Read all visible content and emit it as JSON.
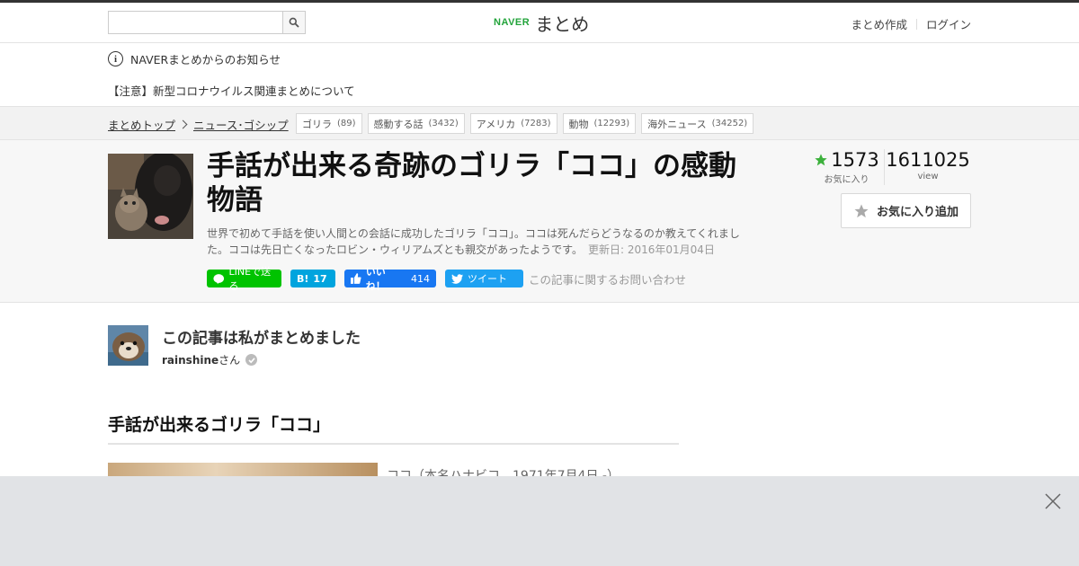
{
  "header": {
    "search": {
      "value": "",
      "placeholder": ""
    },
    "logo": {
      "naver": "NAVER",
      "matome": "まとめ"
    },
    "nav": [
      {
        "label": "まとめ作成"
      },
      {
        "label": "ログイン"
      }
    ]
  },
  "notice": {
    "title": "NAVERまとめからのお知らせ",
    "item": "【注意】新型コロナウイルス関連まとめについて"
  },
  "breadcrumb": {
    "items": [
      {
        "label": "まとめトップ"
      },
      {
        "label": "ニュース･ゴシップ"
      }
    ]
  },
  "tags": [
    {
      "label": "ゴリラ",
      "count": "(89)"
    },
    {
      "label": "感動する話",
      "count": "(3432)"
    },
    {
      "label": "アメリカ",
      "count": "(7283)"
    },
    {
      "label": "動物",
      "count": "(12293)"
    },
    {
      "label": "海外ニュース",
      "count": "(34252)"
    }
  ],
  "article": {
    "title": "手話が出来る奇跡のゴリラ「ココ」の感動物語",
    "description": "世界で初めて手話を使い人間との会話に成功したゴリラ「ココ」。ココは死んだらどうなるのか教えてくれました。ココは先日亡くなったロビン・ウィリアムズとも親交があったようです。",
    "updated": "更新日: 2016年01月04日",
    "share": {
      "line": "LINEで送る",
      "hatena_count": "17",
      "fb_label": "いいね！",
      "fb_count": "414",
      "tweet": "ツイート",
      "contact": "この記事に関するお問い合わせ"
    },
    "stats": {
      "favorites": "1573",
      "favorites_label": "お気に入り",
      "views": "1611025",
      "views_label": "view"
    },
    "fav_button": "お気に入り追加"
  },
  "author": {
    "heading": "この記事は私がまとめました",
    "name": "rainshine",
    "suffix": "さん"
  },
  "section": {
    "heading": "手話が出来るゴリラ「ココ」",
    "first_text": "ココ（本名ハナビコ、1971年7月4日 -）"
  },
  "colors": {
    "brand_green": "#22a33a",
    "line_green": "#00c300",
    "hatena_blue": "#00a4de",
    "facebook_blue": "#1877f2",
    "twitter_blue": "#1da1f2",
    "star_green": "#3cb13c"
  },
  "icons": {
    "search": "search-icon",
    "info": "info-icon",
    "chevron": "chevron-right-icon",
    "star": "star-icon",
    "close": "close-icon",
    "verified": "check-badge-icon"
  }
}
